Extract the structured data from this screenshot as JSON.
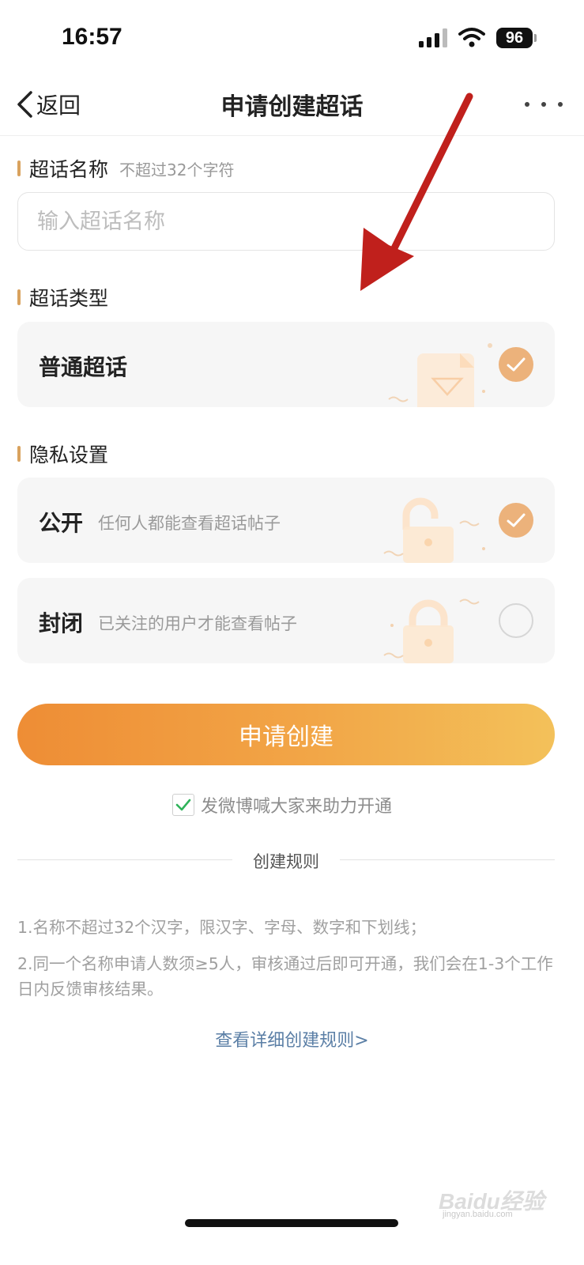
{
  "status_bar": {
    "time": "16:57",
    "battery": "96"
  },
  "nav": {
    "back_label": "返回",
    "title": "申请创建超话"
  },
  "name_section": {
    "title": "超话名称",
    "hint": "不超过32个字符",
    "placeholder": "输入超话名称",
    "value": ""
  },
  "type_section": {
    "title": "超话类型",
    "options": [
      {
        "label": "普通超话",
        "selected": true
      }
    ]
  },
  "privacy_section": {
    "title": "隐私设置",
    "options": [
      {
        "label": "公开",
        "desc": "任何人都能查看超话帖子",
        "selected": true
      },
      {
        "label": "封闭",
        "desc": "已关注的用户才能查看帖子",
        "selected": false
      }
    ]
  },
  "submit_label": "申请创建",
  "agree": {
    "label": "发微博喊大家来助力开通",
    "checked": true
  },
  "rules": {
    "title": "创建规则",
    "items": [
      "1.名称不超过32个汉字，限汉字、字母、数字和下划线；",
      "2.同一个名称申请人数须≥5人，审核通过后即可开通，我们会在1-3个工作日内反馈审核结果。"
    ],
    "link": "查看详细创建规则>"
  },
  "watermark": {
    "brand": "Baidu经验",
    "site": "jingyan.baidu.com"
  },
  "colors": {
    "accent_orange": "#ee8d35",
    "accent_yellow": "#f3c15a",
    "check_fill": "#ecb27b",
    "section_bar": "#d9a25e",
    "link_blue": "#5b7fa6",
    "annotation_red": "#c0201c"
  },
  "icons": {
    "back": "chevron-left-icon",
    "more": "more-dots-icon",
    "check": "check-icon",
    "signal": "signal-icon",
    "wifi": "wifi-icon"
  }
}
